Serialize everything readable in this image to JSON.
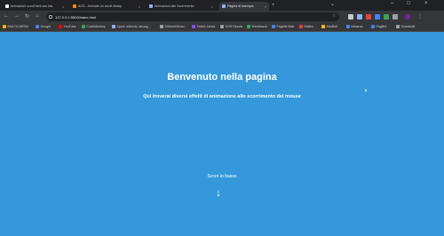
{
  "browser": {
    "tabs": [
      {
        "title": "animazioni scroll html css ess",
        "color": "#ffffff",
        "active": false
      },
      {
        "title": "AOS - Animate on scroll library",
        "color": "#ff8a00",
        "active": false
      },
      {
        "title": "Animazioni allo Scorrimento",
        "color": "#8ab4f8",
        "active": false
      },
      {
        "title": "Pagina di esempio",
        "color": "#8ab4f8",
        "active": true
      }
    ],
    "url": "127.0.0.1:5500/index.html",
    "bookmarks": [
      {
        "label": "MULTICARGA",
        "color": "#f4b400"
      },
      {
        "label": "Google",
        "color": "#4285f4"
      },
      {
        "label": "YouTube",
        "color": "#ff0000"
      },
      {
        "label": "CodeMonkey",
        "color": "#34a853"
      },
      {
        "label": "Sport: mitrovic, strong...",
        "color": "#8ab4f8"
      },
      {
        "label": "2/MonetVerso",
        "color": "#9aa0a6"
      },
      {
        "label": "Twitch Jones",
        "color": "#9146ff"
      },
      {
        "label": "SOS Fasola",
        "color": "#9aa0a6"
      },
      {
        "label": "Weebtrack",
        "color": "#34a853"
      },
      {
        "label": "Pagelle Mail",
        "color": "#4285f4"
      },
      {
        "label": "Mailko",
        "color": "#ea4335"
      },
      {
        "label": "ArtuBelt",
        "color": "#fbbc05"
      },
      {
        "label": "Infoarsa",
        "color": "#4285f4"
      },
      {
        "label": "PagBrit",
        "color": "#4285f4"
      },
      {
        "label": "Scambuilt",
        "color": "#9aa0a6"
      }
    ]
  },
  "page": {
    "heading": "Benvenuto nella pagina",
    "subtitle": "Qui troverai diversi effetti di animazione allo scorrimento del mouse",
    "scroll_hint": "Scorri in basso",
    "arrow": "↓",
    "background_color": "#3498db"
  }
}
